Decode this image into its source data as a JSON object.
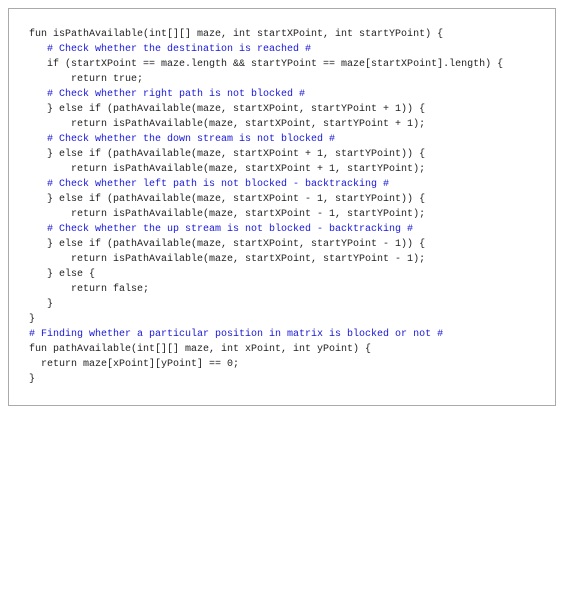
{
  "code": {
    "l1": "fun isPathAvailable(int[][] maze, int startXPoint, int startYPoint) {",
    "l2": "",
    "l3_comment": "   # Check whether the destination is reached #",
    "l4": "   if (startXPoint == maze.length && startYPoint == maze[startXPoint].length) {",
    "l5": "",
    "l6": "       return true;",
    "l7": "",
    "l8_comment": "   # Check whether right path is not blocked #",
    "l9": "   } else if (pathAvailable(maze, startXPoint, startYPoint + 1)) {",
    "l10": "",
    "l11": "       return isPathAvailable(maze, startXPoint, startYPoint + 1);",
    "l12": "",
    "l13_comment": "   # Check whether the down stream is not blocked #",
    "l14": "   } else if (pathAvailable(maze, startXPoint + 1, startYPoint)) {",
    "l15": "",
    "l16": "       return isPathAvailable(maze, startXPoint + 1, startYPoint);",
    "l17": "",
    "l18_comment": "   # Check whether left path is not blocked - backtracking #",
    "l19": "   } else if (pathAvailable(maze, startXPoint - 1, startYPoint)) {",
    "l20": "",
    "l21": "       return isPathAvailable(maze, startXPoint - 1, startYPoint);",
    "l22": "",
    "l23_comment": "   # Check whether the up stream is not blocked - backtracking #",
    "l24": "   } else if (pathAvailable(maze, startXPoint, startYPoint - 1)) {",
    "l25": "",
    "l26": "       return isPathAvailable(maze, startXPoint, startYPoint - 1);",
    "l27": "",
    "l28": "   } else {",
    "l29": "",
    "l30": "       return false;",
    "l31": "",
    "l32": "   }",
    "l33": "",
    "l34": "}",
    "l35": "",
    "l36_comment": "# Finding whether a particular position in matrix is blocked or not #",
    "l37": "fun pathAvailable(int[][] maze, int xPoint, int yPoint) {",
    "l38": "",
    "l39": "  return maze[xPoint][yPoint] == 0;",
    "l40": "",
    "l41": "}"
  }
}
